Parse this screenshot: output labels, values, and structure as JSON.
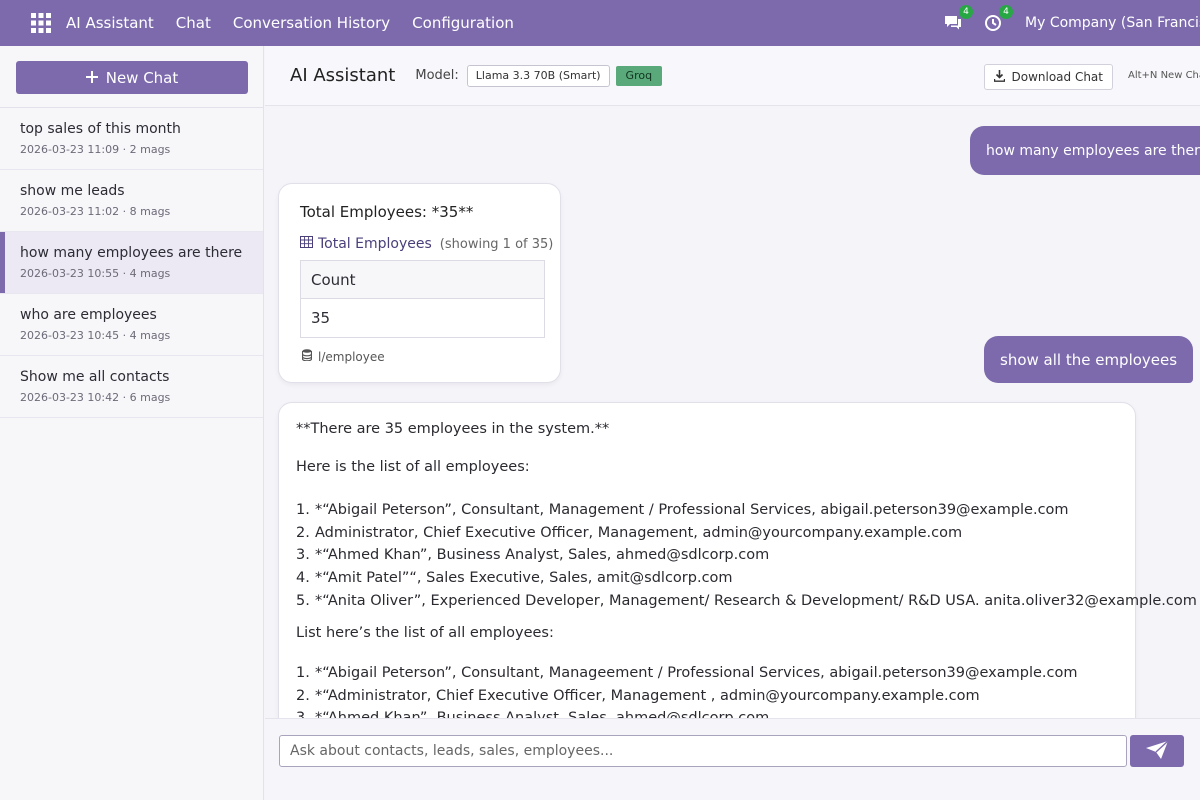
{
  "topbar": {
    "brand": "AI Assistant",
    "nav": [
      "Chat",
      "Conversation History",
      "Configuration"
    ],
    "messages_badge": "4",
    "activity_badge": "4",
    "company": "My Company (San Francisco)"
  },
  "sidebar": {
    "new_chat_label": "New Chat",
    "conversations": [
      {
        "title": "top sales of this month",
        "meta": "2026-03-23 11:09 · 2 mags"
      },
      {
        "title": "show me leads",
        "meta": "2026-03-23 11:02 · 8 mags"
      },
      {
        "title": "how many employees are there",
        "meta": "2026-03-23 10:55 · 4 mags"
      },
      {
        "title": "who are employees",
        "meta": "2026-03-23 10:45 · 4 mags"
      },
      {
        "title": "Show me all contacts",
        "meta": "2026-03-23 10:42 · 6 mags"
      }
    ]
  },
  "header": {
    "title": "AI Assistant",
    "model_label": "Model:",
    "model_value": "Llama 3.3 70B (Smart)",
    "provider": "Groq",
    "download_label": "Download Chat",
    "shortcut_hint": "Alt+N New Chat"
  },
  "chat": {
    "user_msg_1": "how many employees are there",
    "assistant_card": {
      "title": "Total Employees: *35**",
      "table_name": "Total Employees",
      "table_count": "(showing 1 of 35)",
      "column": "Count",
      "value": "35",
      "source": "l/employee"
    },
    "user_msg_2": "show all the employees",
    "response": {
      "line1": "**There are 35 employees in the system.**",
      "line2": "Here is the list of all employees:",
      "list1": [
        {
          "num": "1.",
          "text": "*“Abigail Peterson”, Consultant, Management / Professional Services, abigail.peterson39@example.com"
        },
        {
          "num": "2.",
          "text": "Administrator, Chief Executive Officer, Management, admin@yourcompany.example.com"
        },
        {
          "num": "3.",
          "text": "*“Ahmed Khan”, Business Analyst, Sales, ahmed@sdlcorp.com"
        },
        {
          "num": "4.",
          "text": "*“Amit Patel”“, Sales Executive, Sales, amit@sdlcorp.com"
        },
        {
          "num": "5.",
          "text": "*“Anita Oliver”, Experienced Developer, Management/ Research & Development/ R&D USA. anita.oliver32@example.com"
        }
      ],
      "line3": "List here’s the list of all employees:",
      "list2": [
        {
          "num": "1.",
          "text": "*“Abigail Peterson”, Consultant, Manageement      /  Professional Services, abigail.peterson39@example.com"
        },
        {
          "num": "2.",
          "text": "*“Administrator, Chief Executive Officer, Management , admin@yourcompany.example.com"
        },
        {
          "num": "3.",
          "text": "*“Ahmed Khan”, Business Analyst, Sales, ahmed@sdlcorp.com"
        }
      ]
    }
  },
  "composer": {
    "placeholder": "Ask about contacts, leads, sales, employees..."
  },
  "colors": {
    "brand": "#7c6aad",
    "badge": "#28a745",
    "provider": "#5aa97a"
  }
}
